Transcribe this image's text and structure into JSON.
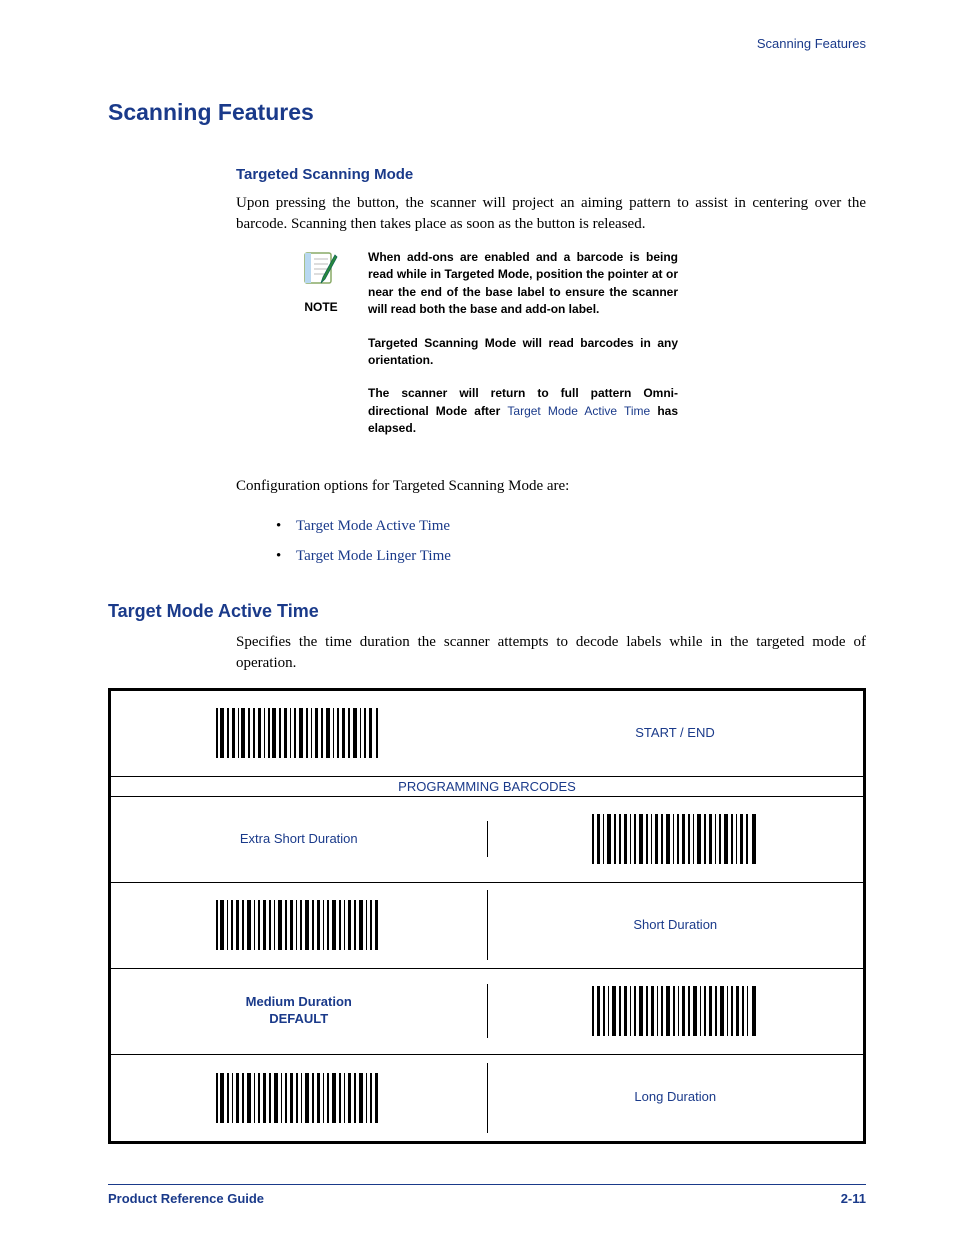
{
  "header": {
    "section": "Scanning Features"
  },
  "h1": "Scanning Features",
  "s1": {
    "title": "Targeted Scanning Mode",
    "body": "Upon pressing the button, the scanner will project an aiming pattern to assist in centering over the barcode. Scanning then takes place as soon as the button is released."
  },
  "note": {
    "label": "NOTE",
    "p1": "When add-ons are enabled and a barcode is being read while in Targeted Mode, position the pointer at or near the end of the base label to ensure the scanner will read both the base and add-on label.",
    "p2": "Targeted Scanning Mode will read barcodes in any orientation.",
    "p3a": "The scanner will return to full pattern Omni-directional Mode after ",
    "p3link": "Target Mode Active Time",
    "p3b": " has elapsed."
  },
  "config_intro": "Configuration options for Targeted Scanning Mode are:",
  "config_items": [
    "Target Mode Active Time",
    "Target Mode Linger Time"
  ],
  "s2": {
    "title": "Target Mode Active Time",
    "body": "Specifies the time duration the scanner attempts to decode labels while in the targeted mode of operation."
  },
  "table": {
    "start_end": "START / END",
    "prog_header": "PROGRAMMING BARCODES",
    "r1": "Extra Short Duration",
    "r2": "Short Duration",
    "r3a": "Medium Duration",
    "r3b": "DEFAULT",
    "r4": "Long Duration"
  },
  "footer": {
    "left": "Product Reference Guide",
    "right": "2-11"
  }
}
